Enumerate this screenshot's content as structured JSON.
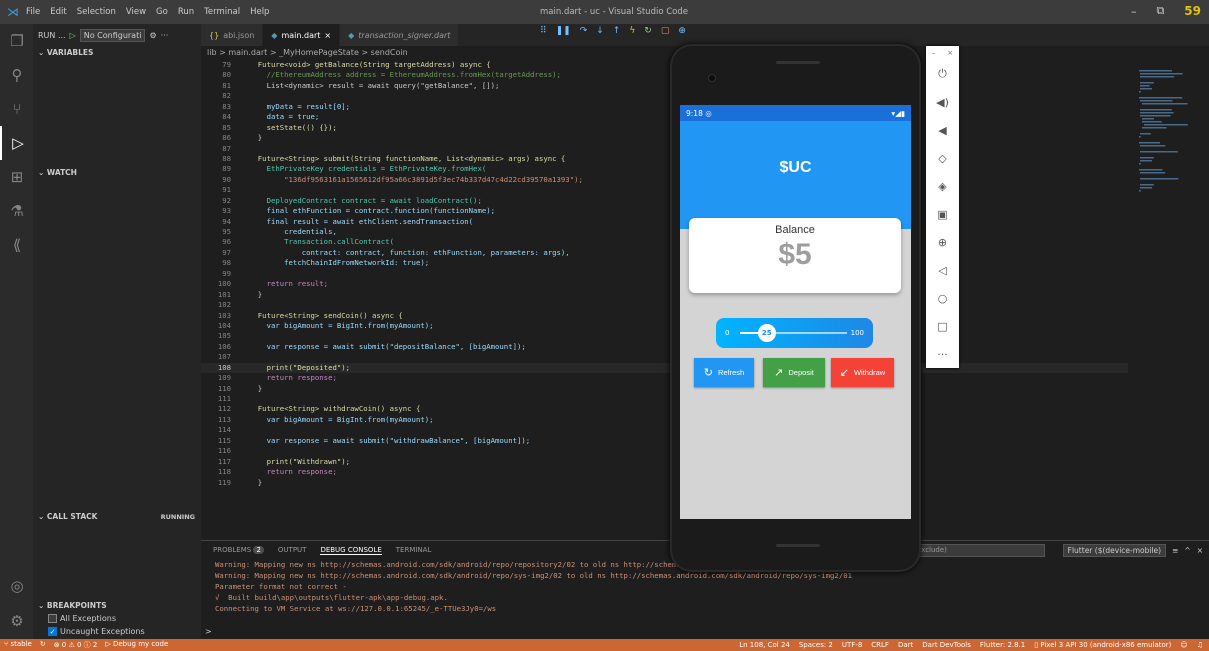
{
  "titlebar": {
    "menu": [
      "File",
      "Edit",
      "Selection",
      "View",
      "Go",
      "Run",
      "Terminal",
      "Help"
    ],
    "title": "main.dart - uc - Visual Studio Code",
    "extra_badge": "59"
  },
  "sidebar": {
    "run_label": "RUN ...",
    "config_label": "No Configurati",
    "sections": {
      "variables": "VARIABLES",
      "watch": "WATCH",
      "call_stack": "CALL STACK",
      "call_stack_status": "RUNNING",
      "breakpoints": "BREAKPOINTS"
    },
    "breakpoints": [
      {
        "label": "All Exceptions",
        "checked": false
      },
      {
        "label": "Uncaught Exceptions",
        "checked": true
      }
    ]
  },
  "tabs": [
    {
      "label": "abi.json",
      "icon": "json-braces-icon",
      "active": false
    },
    {
      "label": "main.dart",
      "icon": "dart-icon",
      "active": true,
      "close": "×"
    },
    {
      "label": "transaction_signer.dart",
      "icon": "dart-icon",
      "active": false
    }
  ],
  "breadcrumb": {
    "parts": [
      "lib",
      "main.dart",
      "_MyHomePageState",
      "sendCoin"
    ],
    "sep": ">"
  },
  "editor": {
    "current_line": 108,
    "lines": [
      {
        "n": "79",
        "t": "  Future<void> getBalance(String targetAddress) async {",
        "c": "cy"
      },
      {
        "n": "80",
        "t": "    //EthereumAddress address = EthereumAddress.fromHex(targetAddress);",
        "c": "cg"
      },
      {
        "n": "81",
        "t": "    List<dynamic> result = await query(\"getBalance\", []);",
        "c": ""
      },
      {
        "n": "82",
        "t": "",
        "c": ""
      },
      {
        "n": "83",
        "t": "    myData = result[0];",
        "c": "cv"
      },
      {
        "n": "84",
        "t": "    data = true;",
        "c": "cv"
      },
      {
        "n": "85",
        "t": "    setState(() {});",
        "c": "cy"
      },
      {
        "n": "86",
        "t": "  }",
        "c": ""
      },
      {
        "n": "87",
        "t": "",
        "c": ""
      },
      {
        "n": "88",
        "t": "  Future<String> submit(String functionName, List<dynamic> args) async {",
        "c": "cy"
      },
      {
        "n": "89",
        "t": "    EthPrivateKey credentials = EthPrivateKey.fromHex(",
        "c": "ct"
      },
      {
        "n": "90",
        "t": "        \"136df9563161a1565612df95a66c3891d5f3ec74b337d47c4d22cd39570a1393\");",
        "c": "cs"
      },
      {
        "n": "91",
        "t": "",
        "c": ""
      },
      {
        "n": "92",
        "t": "    DeployedContract contract = await loadContract();",
        "c": "ct"
      },
      {
        "n": "93",
        "t": "    final ethFunction = contract.function(functionName);",
        "c": "cv"
      },
      {
        "n": "94",
        "t": "    final result = await ethClient.sendTransaction(",
        "c": "cv"
      },
      {
        "n": "95",
        "t": "        credentials,",
        "c": "cv"
      },
      {
        "n": "96",
        "t": "        Transaction.callContract(",
        "c": "ct"
      },
      {
        "n": "97",
        "t": "            contract: contract, function: ethFunction, parameters: args),",
        "c": "cv"
      },
      {
        "n": "98",
        "t": "        fetchChainIdFromNetworkId: true);",
        "c": "cv"
      },
      {
        "n": "99",
        "t": "",
        "c": ""
      },
      {
        "n": "100",
        "t": "    return result;",
        "c": "cp"
      },
      {
        "n": "101",
        "t": "  }",
        "c": ""
      },
      {
        "n": "102",
        "t": "",
        "c": ""
      },
      {
        "n": "103",
        "t": "  Future<String> sendCoin() async {",
        "c": "cy"
      },
      {
        "n": "104",
        "t": "    var bigAmount = BigInt.from(myAmount);",
        "c": "cv"
      },
      {
        "n": "105",
        "t": "",
        "c": ""
      },
      {
        "n": "106",
        "t": "    var response = await submit(\"depositBalance\", [bigAmount]);",
        "c": "cv"
      },
      {
        "n": "107",
        "t": "",
        "c": ""
      },
      {
        "n": "108",
        "t": "    print(\"Deposited\");",
        "c": "cy"
      },
      {
        "n": "109",
        "t": "    return response;",
        "c": "cp"
      },
      {
        "n": "110",
        "t": "  }",
        "c": ""
      },
      {
        "n": "111",
        "t": "",
        "c": ""
      },
      {
        "n": "112",
        "t": "  Future<String> withdrawCoin() async {",
        "c": "cy"
      },
      {
        "n": "113",
        "t": "    var bigAmount = BigInt.from(myAmount);",
        "c": "cv"
      },
      {
        "n": "114",
        "t": "",
        "c": ""
      },
      {
        "n": "115",
        "t": "    var response = await submit(\"withdrawBalance\", [bigAmount]);",
        "c": "cv"
      },
      {
        "n": "116",
        "t": "",
        "c": ""
      },
      {
        "n": "117",
        "t": "    print(\"Withdrawn\");",
        "c": "cy"
      },
      {
        "n": "118",
        "t": "    return response;",
        "c": "cp"
      },
      {
        "n": "119",
        "t": "  }",
        "c": ""
      }
    ]
  },
  "panel": {
    "tabs": [
      {
        "label": "PROBLEMS",
        "badge": "2",
        "active": false
      },
      {
        "label": "OUTPUT",
        "active": false
      },
      {
        "label": "DEBUG CONSOLE",
        "active": true
      },
      {
        "label": "TERMINAL",
        "active": false
      }
    ],
    "filter_placeholder": "(e.g. text, **/*.ts, !**/node_modules/**) exclude)",
    "filter_visible": "exclude)",
    "console_select": "Flutter ($(device-mobile)",
    "lines": [
      {
        "t": "Warning: Mapping new ns http://schemas.android.com/sdk/android/repo/repository2/02 to old ns http://schemas.android.com/sdk/android/repo/repository2/01",
        "c": "or"
      },
      {
        "t": "Warning: Mapping new ns http://schemas.android.com/sdk/android/repo/sys-img2/02 to old ns http://schemas.android.com/sdk/android/repo/sys-img2/01",
        "c": "or"
      },
      {
        "t": "Parameter format not correct -",
        "c": "or"
      },
      {
        "t": "√  Built build\\app\\outputs\\flutter-apk\\app-debug.apk.",
        "c": "or"
      },
      {
        "t": "Connecting to VM Service at ws://127.0.0.1:65245/_e-TTUe3Jy0=/ws",
        "c": "or"
      }
    ],
    "prompt": ">"
  },
  "statusbar": {
    "left": [
      "stable",
      "⊗ 0 ⚠ 0 ⓘ 2",
      "Debug my code"
    ],
    "right": [
      "Ln 108, Col 24",
      "Spaces: 2",
      "UTF-8",
      "CRLF",
      "Dart",
      "Dart DevTools",
      "Flutter: 2.8.1",
      "Pixel 3 API 30 (android-x86 emulator)"
    ]
  },
  "phone": {
    "time": "9:18",
    "app_title": "$UC",
    "balance_label": "Balance",
    "balance_value": "$5",
    "slider": {
      "min": "0",
      "max": "100",
      "value": "25",
      "fraction": 0.25
    },
    "buttons": [
      {
        "label": "Refresh",
        "icon": "refresh-icon",
        "color": "#2196f3"
      },
      {
        "label": "Deposit",
        "icon": "arrow-up-right-icon",
        "color": "#43a047"
      },
      {
        "label": "Withdraw",
        "icon": "arrow-down-left-icon",
        "color": "#f44336"
      }
    ]
  },
  "emulator_controls": [
    "power-icon",
    "volume-up-icon",
    "volume-down-icon",
    "rotate-left-icon",
    "rotate-right-icon",
    "camera-icon",
    "zoom-icon",
    "back-icon",
    "home-icon",
    "overview-icon",
    "more-icon"
  ],
  "colors": {
    "status_bar": "#cc6633",
    "app_blue": "#2196f3"
  }
}
